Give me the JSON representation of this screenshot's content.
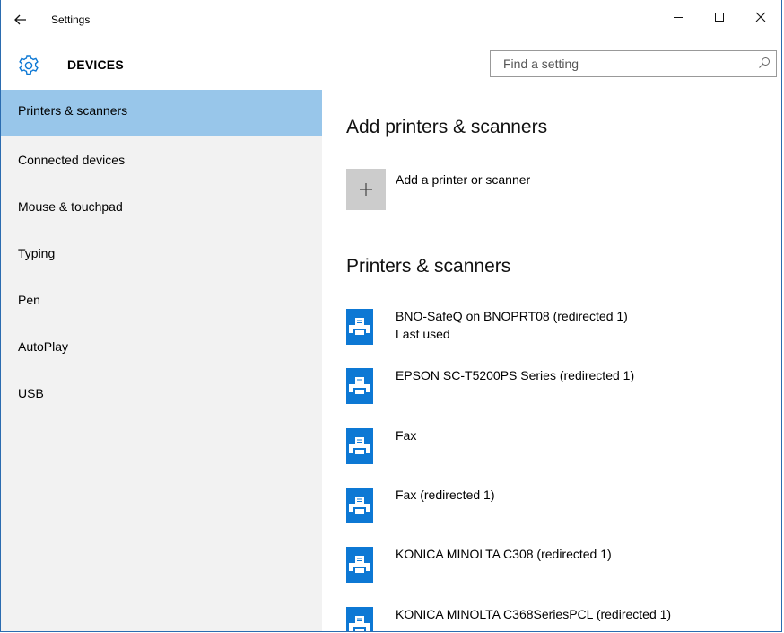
{
  "window": {
    "title": "Settings"
  },
  "header": {
    "section_title": "DEVICES",
    "search_placeholder": "Find a setting"
  },
  "sidebar": {
    "items": [
      {
        "label": "Printers & scanners"
      },
      {
        "label": "Connected devices"
      },
      {
        "label": "Mouse & touchpad"
      },
      {
        "label": "Typing"
      },
      {
        "label": "Pen"
      },
      {
        "label": "AutoPlay"
      },
      {
        "label": "USB"
      }
    ]
  },
  "main": {
    "add_heading": "Add printers & scanners",
    "add_button_label": "Add a printer or scanner",
    "list_heading": "Printers & scanners",
    "printers": [
      {
        "name": "BNO-SafeQ on BNOPRT08 (redirected 1)",
        "status": "Last used"
      },
      {
        "name": "EPSON SC-T5200PS Series (redirected 1)",
        "status": ""
      },
      {
        "name": "Fax",
        "status": ""
      },
      {
        "name": "Fax (redirected 1)",
        "status": ""
      },
      {
        "name": "KONICA MINOLTA C308 (redirected 1)",
        "status": ""
      },
      {
        "name": "KONICA MINOLTA C368SeriesPCL (redirected 1)",
        "status": ""
      }
    ]
  },
  "colors": {
    "accent": "#0d78d4",
    "sidebar_selected": "#98c6ea",
    "sidebar_bg": "#f2f2f2",
    "add_tile": "#cccccc",
    "window_border": "#2b6cb0"
  },
  "icons": {
    "back": "back-arrow-icon",
    "gear": "gear-icon",
    "search": "search-icon",
    "add": "plus-icon",
    "printer": "printer-icon",
    "minimize": "minimize-icon",
    "maximize": "maximize-icon",
    "close": "close-icon"
  }
}
